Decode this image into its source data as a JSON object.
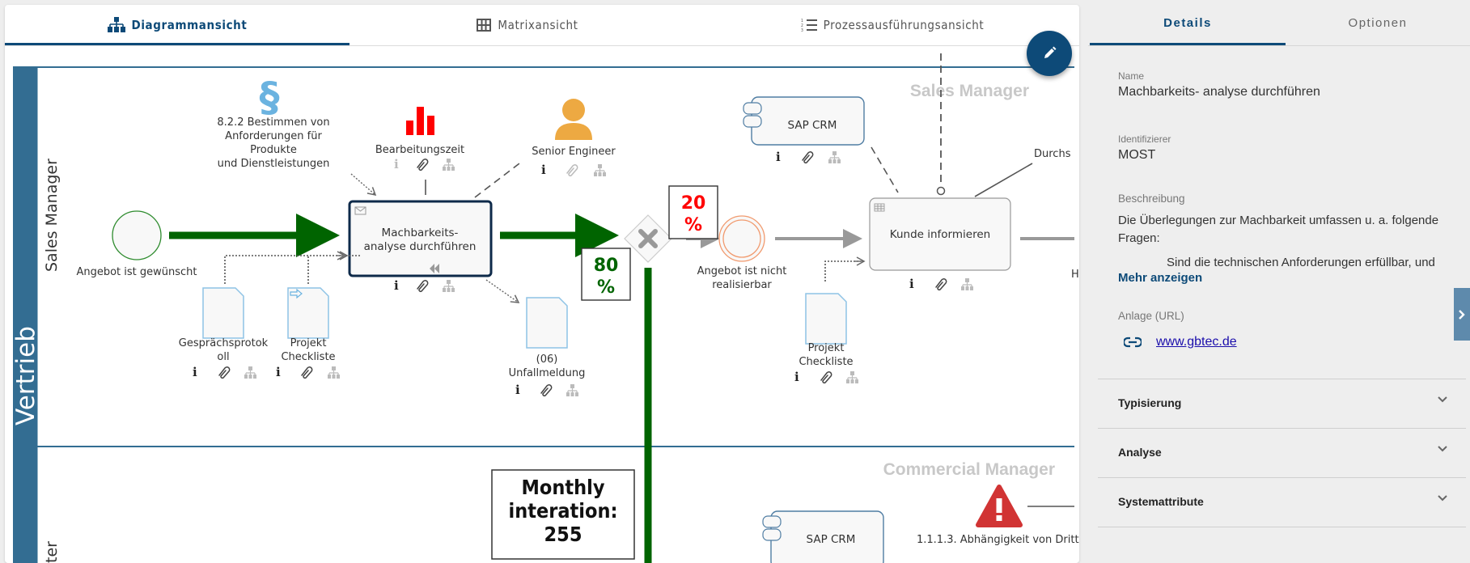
{
  "view_tabs": [
    {
      "label": "Diagrammansicht",
      "icon": "sitemap-icon",
      "active": true
    },
    {
      "label": "Matrixansicht",
      "icon": "grid-icon",
      "active": false
    },
    {
      "label": "Prozessausführungsansicht",
      "icon": "numbered-list-icon",
      "active": false
    }
  ],
  "fab": {
    "icon": "pencil-icon",
    "label": "Edit"
  },
  "diagram": {
    "pool": {
      "label": "Vertrieb",
      "color": "#336d92"
    },
    "lanes": [
      {
        "label": "Sales Manager",
        "watermark": "Sales Manager"
      },
      {
        "label": "ter",
        "watermark": "Commercial Manager"
      }
    ],
    "elements": {
      "start_event": {
        "label": "Angebot ist gewünscht"
      },
      "norm": {
        "icon": "paragraph-icon",
        "lines": [
          "8.2.2 Bestimmen von",
          "Anforderungen für",
          "Produkte",
          "und Dienstleistungen"
        ]
      },
      "kpi": {
        "icon": "bar-chart-icon",
        "label": "Bearbeitungszeit"
      },
      "role": {
        "icon": "person-icon",
        "label": "Senior Engineer"
      },
      "task_main": {
        "lines": [
          "Machbarkeits-",
          "analyse durchführen"
        ]
      },
      "doc_gespraech": {
        "lines": [
          "Gesprächsprotok",
          "oll"
        ]
      },
      "doc_checklist_1": {
        "lines": [
          "Projekt",
          "Checkliste"
        ]
      },
      "doc_unfall": {
        "lines": [
          "(06)",
          "Unfallmeldung"
        ]
      },
      "gateway": {
        "icon": "xor-gateway-icon"
      },
      "prob_yes": {
        "value": "80",
        "unit": "%",
        "color": "#006400"
      },
      "prob_no": {
        "value": "20",
        "unit": "%",
        "color": "#ff0000"
      },
      "end_event": {
        "lines": [
          "Angebot ist nicht",
          "realisierbar"
        ]
      },
      "system_1": {
        "label": "SAP CRM"
      },
      "task_inform": {
        "label": "Kunde informieren"
      },
      "doc_checklist_2": {
        "lines": [
          "Projekt",
          "Checkliste"
        ]
      },
      "partial_label": {
        "label": "Durchs"
      },
      "monthly": {
        "lines": [
          "Monthly",
          "interation:",
          "255"
        ]
      },
      "system_2": {
        "label": "SAP CRM"
      },
      "risk": {
        "icon": "warning-triangle-icon",
        "label": "1.1.1.3. Abhängigkeit von Dritt"
      }
    },
    "flow_color": "#006400"
  },
  "panel": {
    "tabs": [
      {
        "label": "Details",
        "active": true
      },
      {
        "label": "Optionen",
        "active": false
      }
    ],
    "fields": {
      "name_label": "Name",
      "name_value": "Machbarkeits- analyse durchführen",
      "id_label": "Identifizierer",
      "id_value": "MOST",
      "desc_label": "Beschreibung",
      "desc_value": "Die Überlegungen zur Machbarkeit umfassen u. a. folgende Fragen:",
      "desc_more_line": "Sind die technischen Anforderungen erfüllbar, und",
      "more_label": "Mehr anzeigen",
      "url_label": "Anlage (URL)",
      "url_value": "www.gbtec.de"
    },
    "accordions": [
      {
        "label": "Typisierung"
      },
      {
        "label": "Analyse"
      },
      {
        "label": "Systemattribute"
      }
    ],
    "accent": "#0d4a78"
  }
}
